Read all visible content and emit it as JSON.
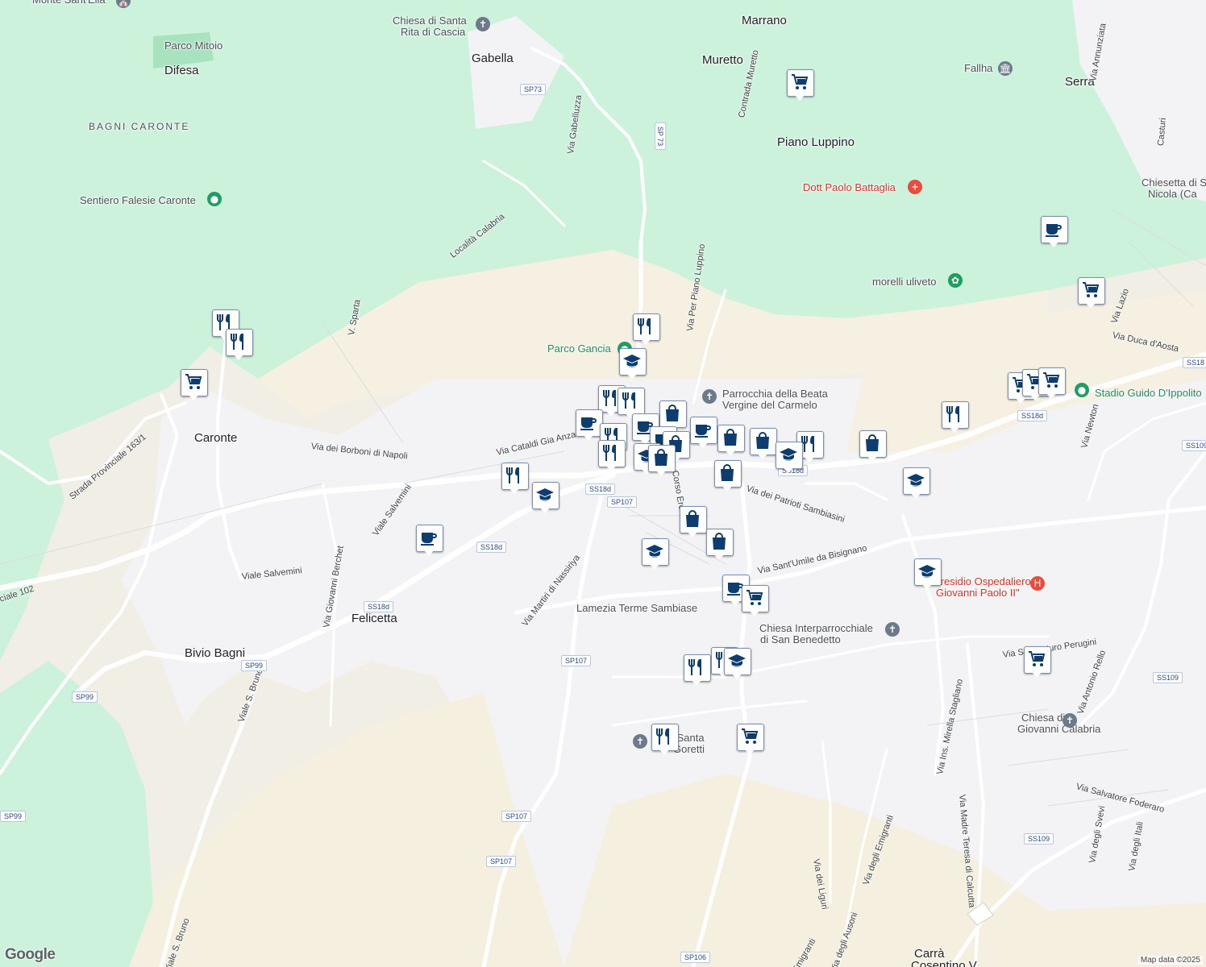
{
  "map": {
    "attribution": "Map data ©2025",
    "logo": "Google",
    "places": [
      {
        "text": "Monte Sant'Elia",
        "kind": "poi"
      },
      {
        "text": "Parco Mitoio",
        "kind": "poi"
      },
      {
        "text": "Difesa",
        "kind": "big"
      },
      {
        "text": "BAGNI CARONTE",
        "kind": "area"
      },
      {
        "text": "Sentiero Falesie Caronte",
        "kind": "poi"
      },
      {
        "text": "Chiesa di Santa",
        "kind": "poi"
      },
      {
        "text": "Rita di Cascia",
        "kind": "poi"
      },
      {
        "text": "Gabella",
        "kind": "big"
      },
      {
        "text": "Marrano",
        "kind": "big"
      },
      {
        "text": "Muretto",
        "kind": "big"
      },
      {
        "text": "Fallha",
        "kind": "poi"
      },
      {
        "text": "Serra",
        "kind": "big"
      },
      {
        "text": "Piano Luppino",
        "kind": "big"
      },
      {
        "text": "Dott Paolo Battaglia",
        "kind": "red"
      },
      {
        "text": "Chiesetta di S",
        "kind": "poi"
      },
      {
        "text": "Nicola (Ca",
        "kind": "poi"
      },
      {
        "text": "morelli uliveto",
        "kind": "poi"
      },
      {
        "text": "Parco Gancia",
        "kind": "green"
      },
      {
        "text": "Parrocchia della Beata",
        "kind": "poi"
      },
      {
        "text": "Vergine del Carmelo",
        "kind": "poi"
      },
      {
        "text": "Stadio Guido D'Ippolito",
        "kind": "green"
      },
      {
        "text": "Caronte",
        "kind": "big"
      },
      {
        "text": "Felicetta",
        "kind": "big"
      },
      {
        "text": "Bivio Bagni",
        "kind": "big"
      },
      {
        "text": "Lamezia Terme Sambiase",
        "kind": "poi"
      },
      {
        "text": "Chiesa Interparrocchiale",
        "kind": "poi"
      },
      {
        "text": "di San Benedetto",
        "kind": "poi"
      },
      {
        "text": "Presidio Ospedaliero",
        "kind": "red"
      },
      {
        "text": "Giovanni Paolo II\"",
        "kind": "red"
      },
      {
        "text": "Chiesa di S.",
        "kind": "poi"
      },
      {
        "text": "Giovanni Calabria",
        "kind": "poi"
      },
      {
        "text": "a di Santa",
        "kind": "poi"
      },
      {
        "text": "Goretti",
        "kind": "poi"
      },
      {
        "text": "Carrà",
        "kind": "big"
      },
      {
        "text": "Cosentino V",
        "kind": "big"
      }
    ],
    "streets": [
      "Località Calabria",
      "V. Sparta",
      "Via Gabelluzza",
      "Contrada Muretto",
      "Via Per Piano Luppino",
      "Via Annunziata",
      "Casturi",
      "Via Lazio",
      "Via Duca d'Aosta",
      "Via Newton",
      "Via dei Borboni di Napoli",
      "Via Cataldi Gia Anza",
      "Strada Provinciale 163/1",
      "Viale Salvemini",
      "Viale Salvemini",
      "Via Giovanni Berchet",
      "ciale 102",
      "Via Martiri di Nassiriya",
      "Corso Eroi",
      "Via dei Patrioti Sambiasini",
      "Via Sant'Umile da Bisignano",
      "Via Sen. Arturo Perugini",
      "Via Antonio Rello",
      "Via Ins. Mirella Stagliano",
      "Via Madre Teresa di Calcutta",
      "Via degli Emigranti",
      "Via dei Liguri",
      "Via Salvatore Foderaro",
      "Via degli Svevi",
      "Via degli Itali",
      "Viale S. Bruno",
      "Viale S. Bruno",
      "Via degli Ausoni",
      "Emigranti"
    ],
    "shields": [
      "SP73",
      "SP 73",
      "SS18d",
      "SP107",
      "SS18d",
      "SS18d",
      "SP99",
      "SP99",
      "SP107",
      "SP107",
      "SP107",
      "SP106",
      "SS18d",
      "SS18",
      "SS109",
      "SS109",
      "SS109",
      "SP99",
      "SS18d"
    ],
    "markers": [
      {
        "type": "shopping-cart"
      },
      {
        "type": "coffee"
      },
      {
        "type": "shopping-cart"
      },
      {
        "type": "restaurant"
      },
      {
        "type": "restaurant"
      },
      {
        "type": "shopping-cart"
      },
      {
        "type": "restaurant"
      },
      {
        "type": "school"
      },
      {
        "type": "restaurant"
      },
      {
        "type": "restaurant"
      },
      {
        "type": "shopping-bag"
      },
      {
        "type": "coffee"
      },
      {
        "type": "restaurant"
      },
      {
        "type": "coffee"
      },
      {
        "type": "coffee"
      },
      {
        "type": "shopping-bag"
      },
      {
        "type": "coffee"
      },
      {
        "type": "shopping-bag"
      },
      {
        "type": "shopping-bag"
      },
      {
        "type": "restaurant"
      },
      {
        "type": "school"
      },
      {
        "type": "restaurant"
      },
      {
        "type": "school"
      },
      {
        "type": "shopping-bag"
      },
      {
        "type": "shopping-bag"
      },
      {
        "type": "shopping-bag"
      },
      {
        "type": "shopping-bag"
      },
      {
        "type": "restaurant"
      },
      {
        "type": "school"
      },
      {
        "type": "coffee"
      },
      {
        "type": "shopping-bag"
      },
      {
        "type": "school"
      },
      {
        "type": "restaurant"
      },
      {
        "type": "shopping-cart"
      },
      {
        "type": "shopping-cart"
      },
      {
        "type": "shopping-cart"
      },
      {
        "type": "restaurant"
      },
      {
        "type": "school"
      },
      {
        "type": "school"
      },
      {
        "type": "coffee"
      },
      {
        "type": "shopping-cart"
      },
      {
        "type": "restaurant"
      },
      {
        "type": "school"
      },
      {
        "type": "restaurant"
      },
      {
        "type": "shopping-cart"
      },
      {
        "type": "shopping-cart"
      }
    ],
    "colors": {
      "marker": "#0c3d6e",
      "land": "#f1eee6",
      "forest": "#cdf2dc",
      "urban": "#f3f3f5",
      "road": "#ffffff",
      "hospital": "#e94b3c",
      "park": "#1e9e63"
    }
  }
}
